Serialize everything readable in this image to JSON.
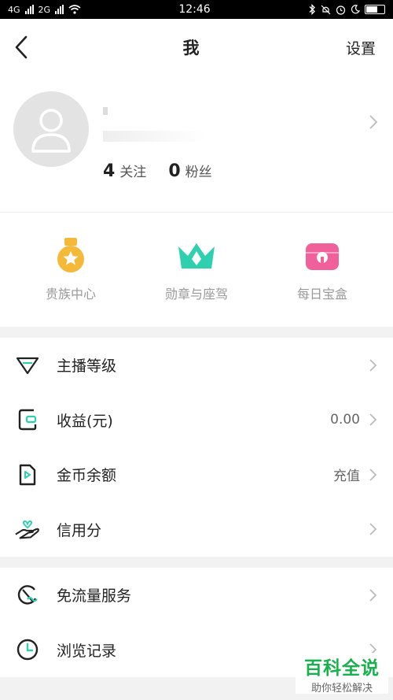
{
  "status_bar": {
    "left_signal_1": "4G",
    "left_signal_2": "2G",
    "time": "12:46"
  },
  "nav": {
    "title": "我",
    "settings_label": "设置"
  },
  "profile": {
    "following_count": "4",
    "following_label": "关注",
    "fans_count": "0",
    "fans_label": "粉丝"
  },
  "quick_actions": [
    {
      "label": "贵族中心",
      "icon": "medal-icon",
      "color": "#f5b93a"
    },
    {
      "label": "勋章与座驾",
      "icon": "crown-icon",
      "color": "#2fd0b0"
    },
    {
      "label": "每日宝盒",
      "icon": "treasure-box-icon",
      "color": "#f0609a"
    }
  ],
  "menu_group_1": [
    {
      "label": "主播等级",
      "value": "",
      "icon": "diamond-icon"
    },
    {
      "label": "收益(元)",
      "value": "0.00",
      "icon": "wallet-icon"
    },
    {
      "label": "金币余额",
      "value": "充值",
      "icon": "coin-play-icon"
    },
    {
      "label": "信用分",
      "value": "",
      "icon": "hand-heart-icon"
    }
  ],
  "menu_group_2": [
    {
      "label": "免流量服务",
      "value": "",
      "icon": "data-free-icon"
    },
    {
      "label": "浏览记录",
      "value": "",
      "icon": "clock-icon"
    }
  ],
  "watermark": {
    "title": "百科全说",
    "subtitle": "助你轻松解决"
  },
  "colors": {
    "accent": "#2fd0b0",
    "watermark_green": "#17b24c"
  }
}
